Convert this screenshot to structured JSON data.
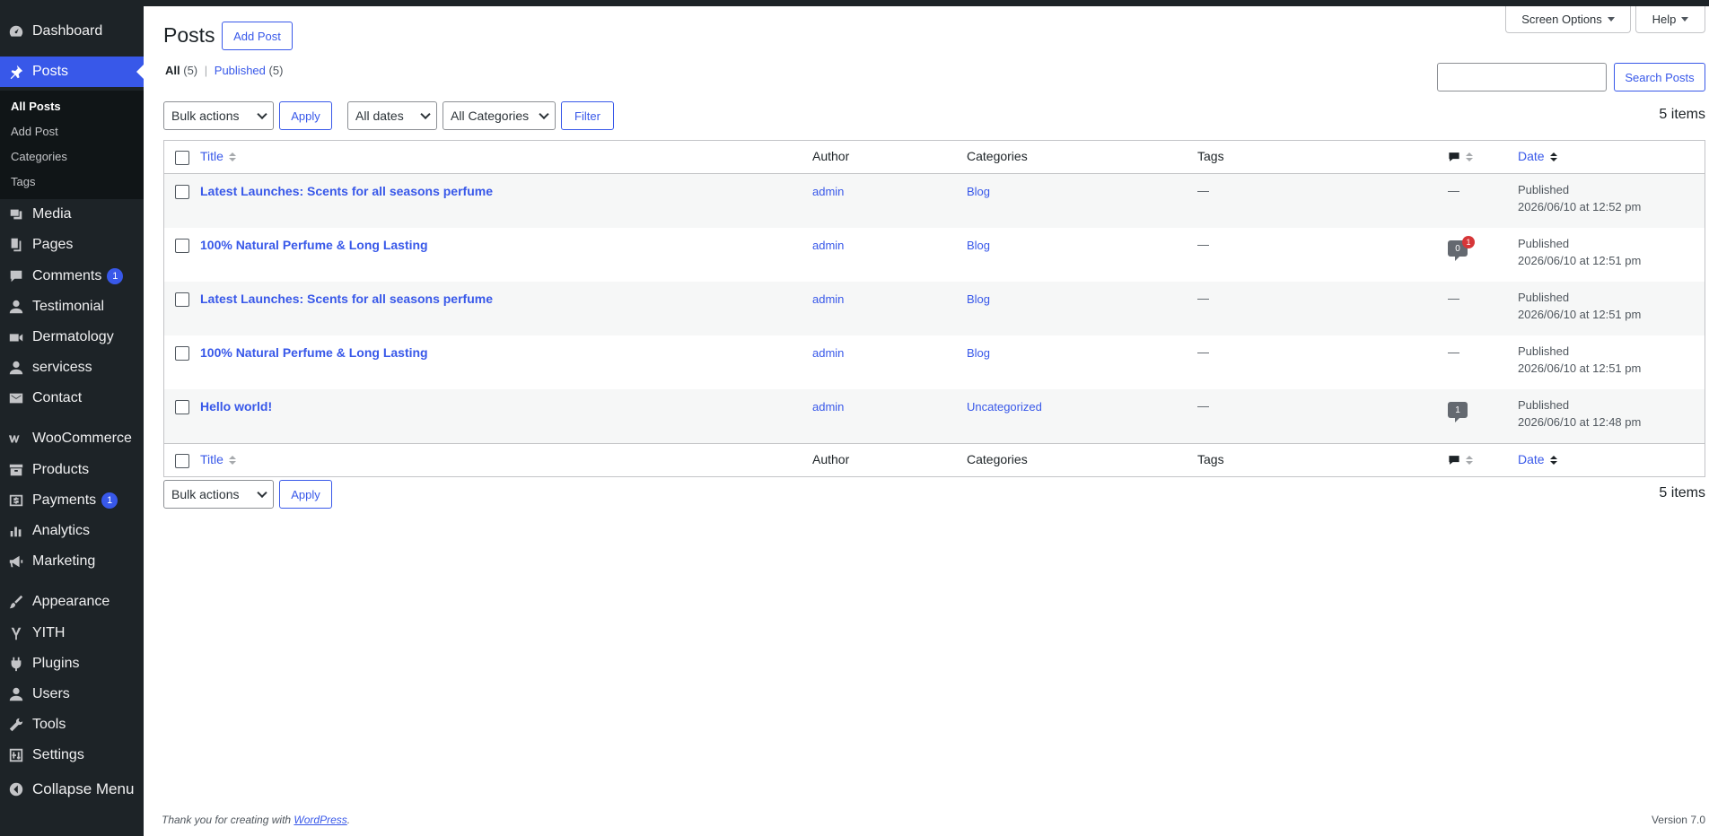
{
  "sidebar": {
    "items": [
      {
        "label": "Dashboard",
        "icon": "dashboard-icon"
      },
      {
        "label": "Posts",
        "icon": "pin-icon"
      },
      {
        "label": "Media",
        "icon": "media-icon"
      },
      {
        "label": "Pages",
        "icon": "pages-icon"
      },
      {
        "label": "Comments",
        "icon": "comment-icon",
        "badge": "1"
      },
      {
        "label": "Testimonial",
        "icon": "user-icon"
      },
      {
        "label": "Dermatology",
        "icon": "video-icon"
      },
      {
        "label": "servicess",
        "icon": "user-icon"
      },
      {
        "label": "Contact",
        "icon": "mail-icon"
      },
      {
        "label": "WooCommerce",
        "icon": "woo-icon"
      },
      {
        "label": "Products",
        "icon": "archive-icon"
      },
      {
        "label": "Payments",
        "icon": "payment-icon",
        "badge": "1"
      },
      {
        "label": "Analytics",
        "icon": "chart-icon"
      },
      {
        "label": "Marketing",
        "icon": "megaphone-icon"
      },
      {
        "label": "Appearance",
        "icon": "brush-icon"
      },
      {
        "label": "YITH",
        "icon": "yith-icon"
      },
      {
        "label": "Plugins",
        "icon": "plugin-icon"
      },
      {
        "label": "Users",
        "icon": "user-icon"
      },
      {
        "label": "Tools",
        "icon": "wrench-icon"
      },
      {
        "label": "Settings",
        "icon": "settings-icon"
      },
      {
        "label": "Collapse Menu",
        "icon": "collapse-icon"
      }
    ],
    "submenu": [
      "All Posts",
      "Add Post",
      "Categories",
      "Tags"
    ]
  },
  "header": {
    "title": "Posts",
    "add_label": "Add Post",
    "screen_options": "Screen Options",
    "help": "Help"
  },
  "views": {
    "all_label": "All",
    "all_count": "(5)",
    "separator": "|",
    "published_label": "Published",
    "published_count": "(5)"
  },
  "search": {
    "value": "",
    "button": "Search Posts"
  },
  "filters": {
    "bulk": "Bulk actions",
    "apply": "Apply",
    "dates": "All dates",
    "categories": "All Categories",
    "filter": "Filter",
    "count": "5 items"
  },
  "columns": {
    "title": "Title",
    "author": "Author",
    "categories": "Categories",
    "tags": "Tags",
    "date": "Date"
  },
  "posts": [
    {
      "title": "Latest Launches: Scents for all seasons perfume",
      "author": "admin",
      "category": "Blog",
      "tags": "—",
      "comments": "—",
      "status": "Published",
      "date": "2026/06/10 at 12:52 pm"
    },
    {
      "title": "100% Natural Perfume & Long Lasting",
      "author": "admin",
      "category": "Blog",
      "tags": "—",
      "comments": "0",
      "pending": "1",
      "status": "Published",
      "date": "2026/06/10 at 12:51 pm"
    },
    {
      "title": "Latest Launches: Scents for all seasons perfume",
      "author": "admin",
      "category": "Blog",
      "tags": "—",
      "comments": "—",
      "status": "Published",
      "date": "2026/06/10 at 12:51 pm"
    },
    {
      "title": "100% Natural Perfume & Long Lasting",
      "author": "admin",
      "category": "Blog",
      "tags": "—",
      "comments": "—",
      "status": "Published",
      "date": "2026/06/10 at 12:51 pm"
    },
    {
      "title": "Hello world!",
      "author": "admin",
      "category": "Uncategorized",
      "tags": "—",
      "comments": "1",
      "status": "Published",
      "date": "2026/06/10 at 12:48 pm"
    }
  ],
  "footer": {
    "thanks_prefix": "Thank you for creating with",
    "thanks_link": "WordPress",
    "thanks_suffix": ".",
    "version": "Version 7.0"
  },
  "colors": {
    "accent": "#3858e9",
    "sidebar": "#1d2327",
    "pending": "#d63638"
  }
}
